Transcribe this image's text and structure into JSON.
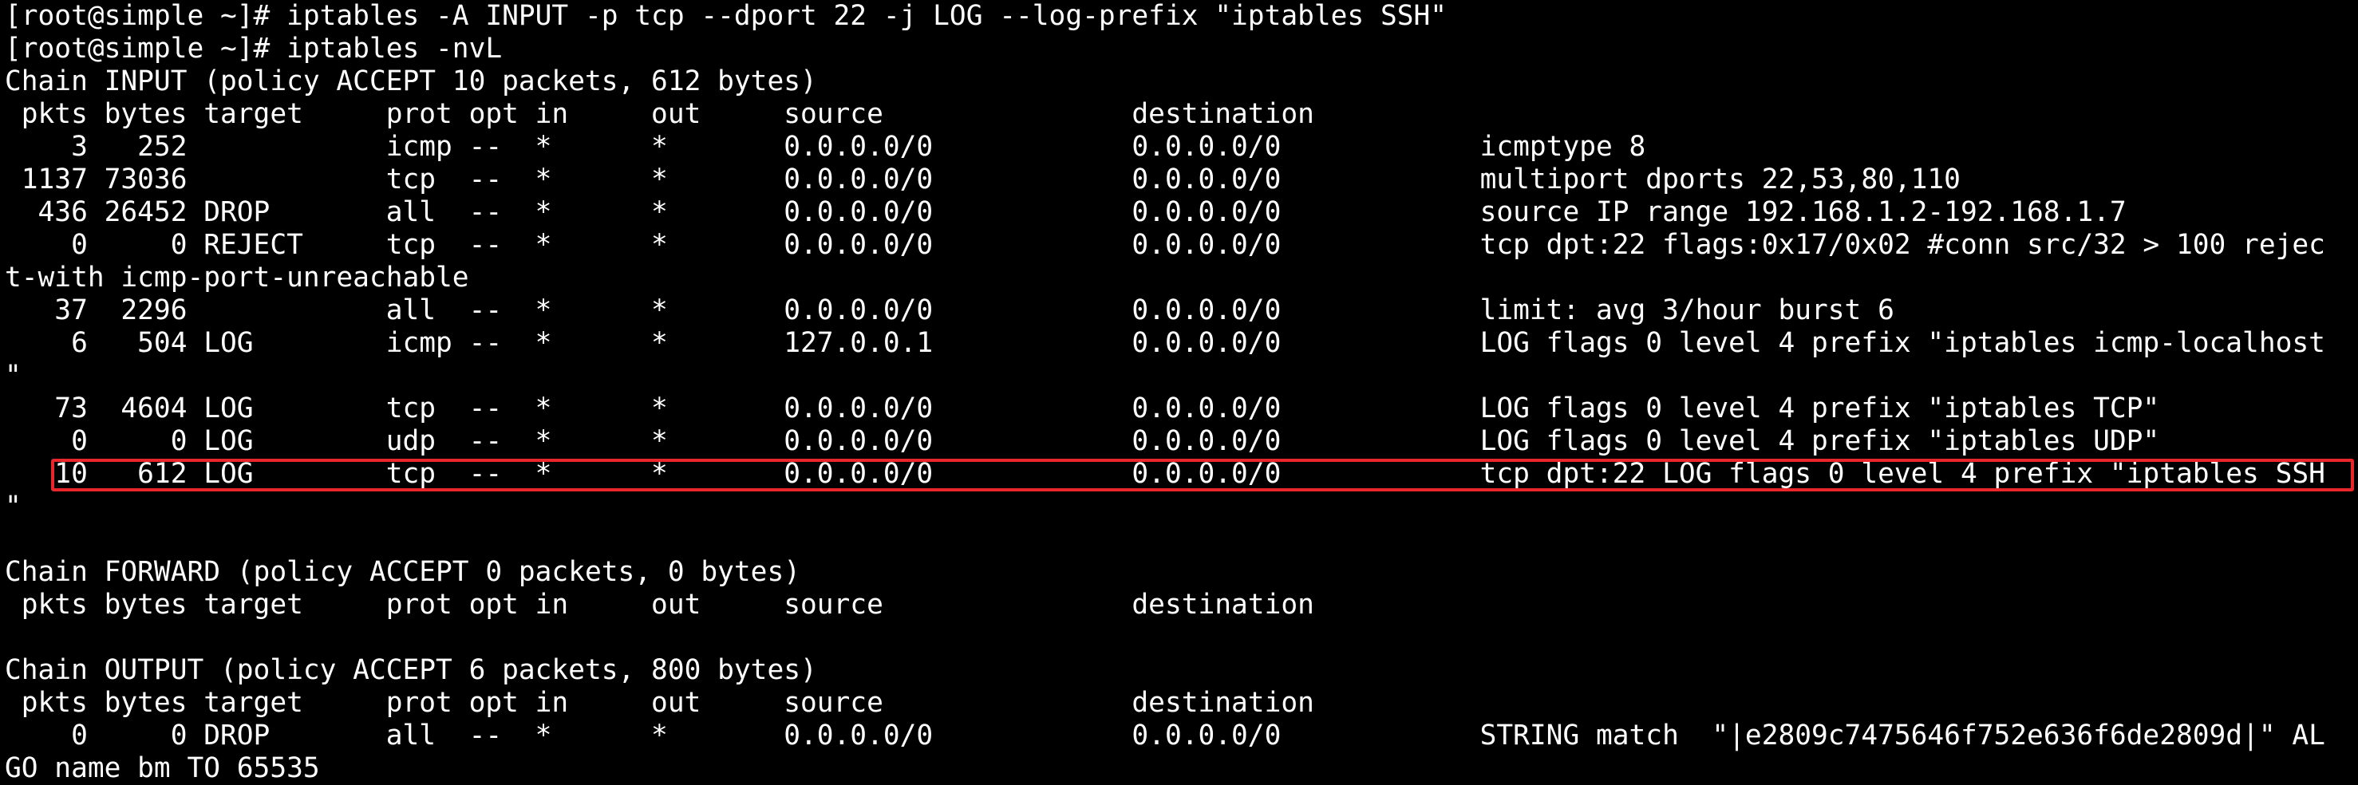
{
  "terminal": {
    "background": "#000000",
    "foreground": "#ffffff",
    "highlight_color": "#e8262b",
    "lines": [
      "[root@simple ~]# iptables -A INPUT -p tcp --dport 22 -j LOG --log-prefix \"iptables SSH\"",
      "[root@simple ~]# iptables -nvL",
      "Chain INPUT (policy ACCEPT 10 packets, 612 bytes)",
      " pkts bytes target     prot opt in     out     source               destination",
      "    3   252            icmp --  *      *       0.0.0.0/0            0.0.0.0/0            icmptype 8",
      " 1137 73036            tcp  --  *      *       0.0.0.0/0            0.0.0.0/0            multiport dports 22,53,80,110",
      "  436 26452 DROP       all  --  *      *       0.0.0.0/0            0.0.0.0/0            source IP range 192.168.1.2-192.168.1.7",
      "    0     0 REJECT     tcp  --  *      *       0.0.0.0/0            0.0.0.0/0            tcp dpt:22 flags:0x17/0x02 #conn src/32 > 100 rejec",
      "t-with icmp-port-unreachable",
      "   37  2296            all  --  *      *       0.0.0.0/0            0.0.0.0/0            limit: avg 3/hour burst 6",
      "    6   504 LOG        icmp --  *      *       127.0.0.1            0.0.0.0/0            LOG flags 0 level 4 prefix \"iptables icmp-localhost",
      "\"",
      "   73  4604 LOG        tcp  --  *      *       0.0.0.0/0            0.0.0.0/0            LOG flags 0 level 4 prefix \"iptables TCP\"",
      "    0     0 LOG        udp  --  *      *       0.0.0.0/0            0.0.0.0/0            LOG flags 0 level 4 prefix \"iptables UDP\"",
      "   10   612 LOG        tcp  --  *      *       0.0.0.0/0            0.0.0.0/0            tcp dpt:22 LOG flags 0 level 4 prefix \"iptables SSH",
      "\"",
      "",
      "Chain FORWARD (policy ACCEPT 0 packets, 0 bytes)",
      " pkts bytes target     prot opt in     out     source               destination",
      "",
      "Chain OUTPUT (policy ACCEPT 6 packets, 800 bytes)",
      " pkts bytes target     prot opt in     out     source               destination",
      "    0     0 DROP       all  --  *      *       0.0.0.0/0            0.0.0.0/0            STRING match  \"|e2809c7475646f752e636f6de2809d|\" AL",
      "GO name bm TO 65535"
    ]
  }
}
